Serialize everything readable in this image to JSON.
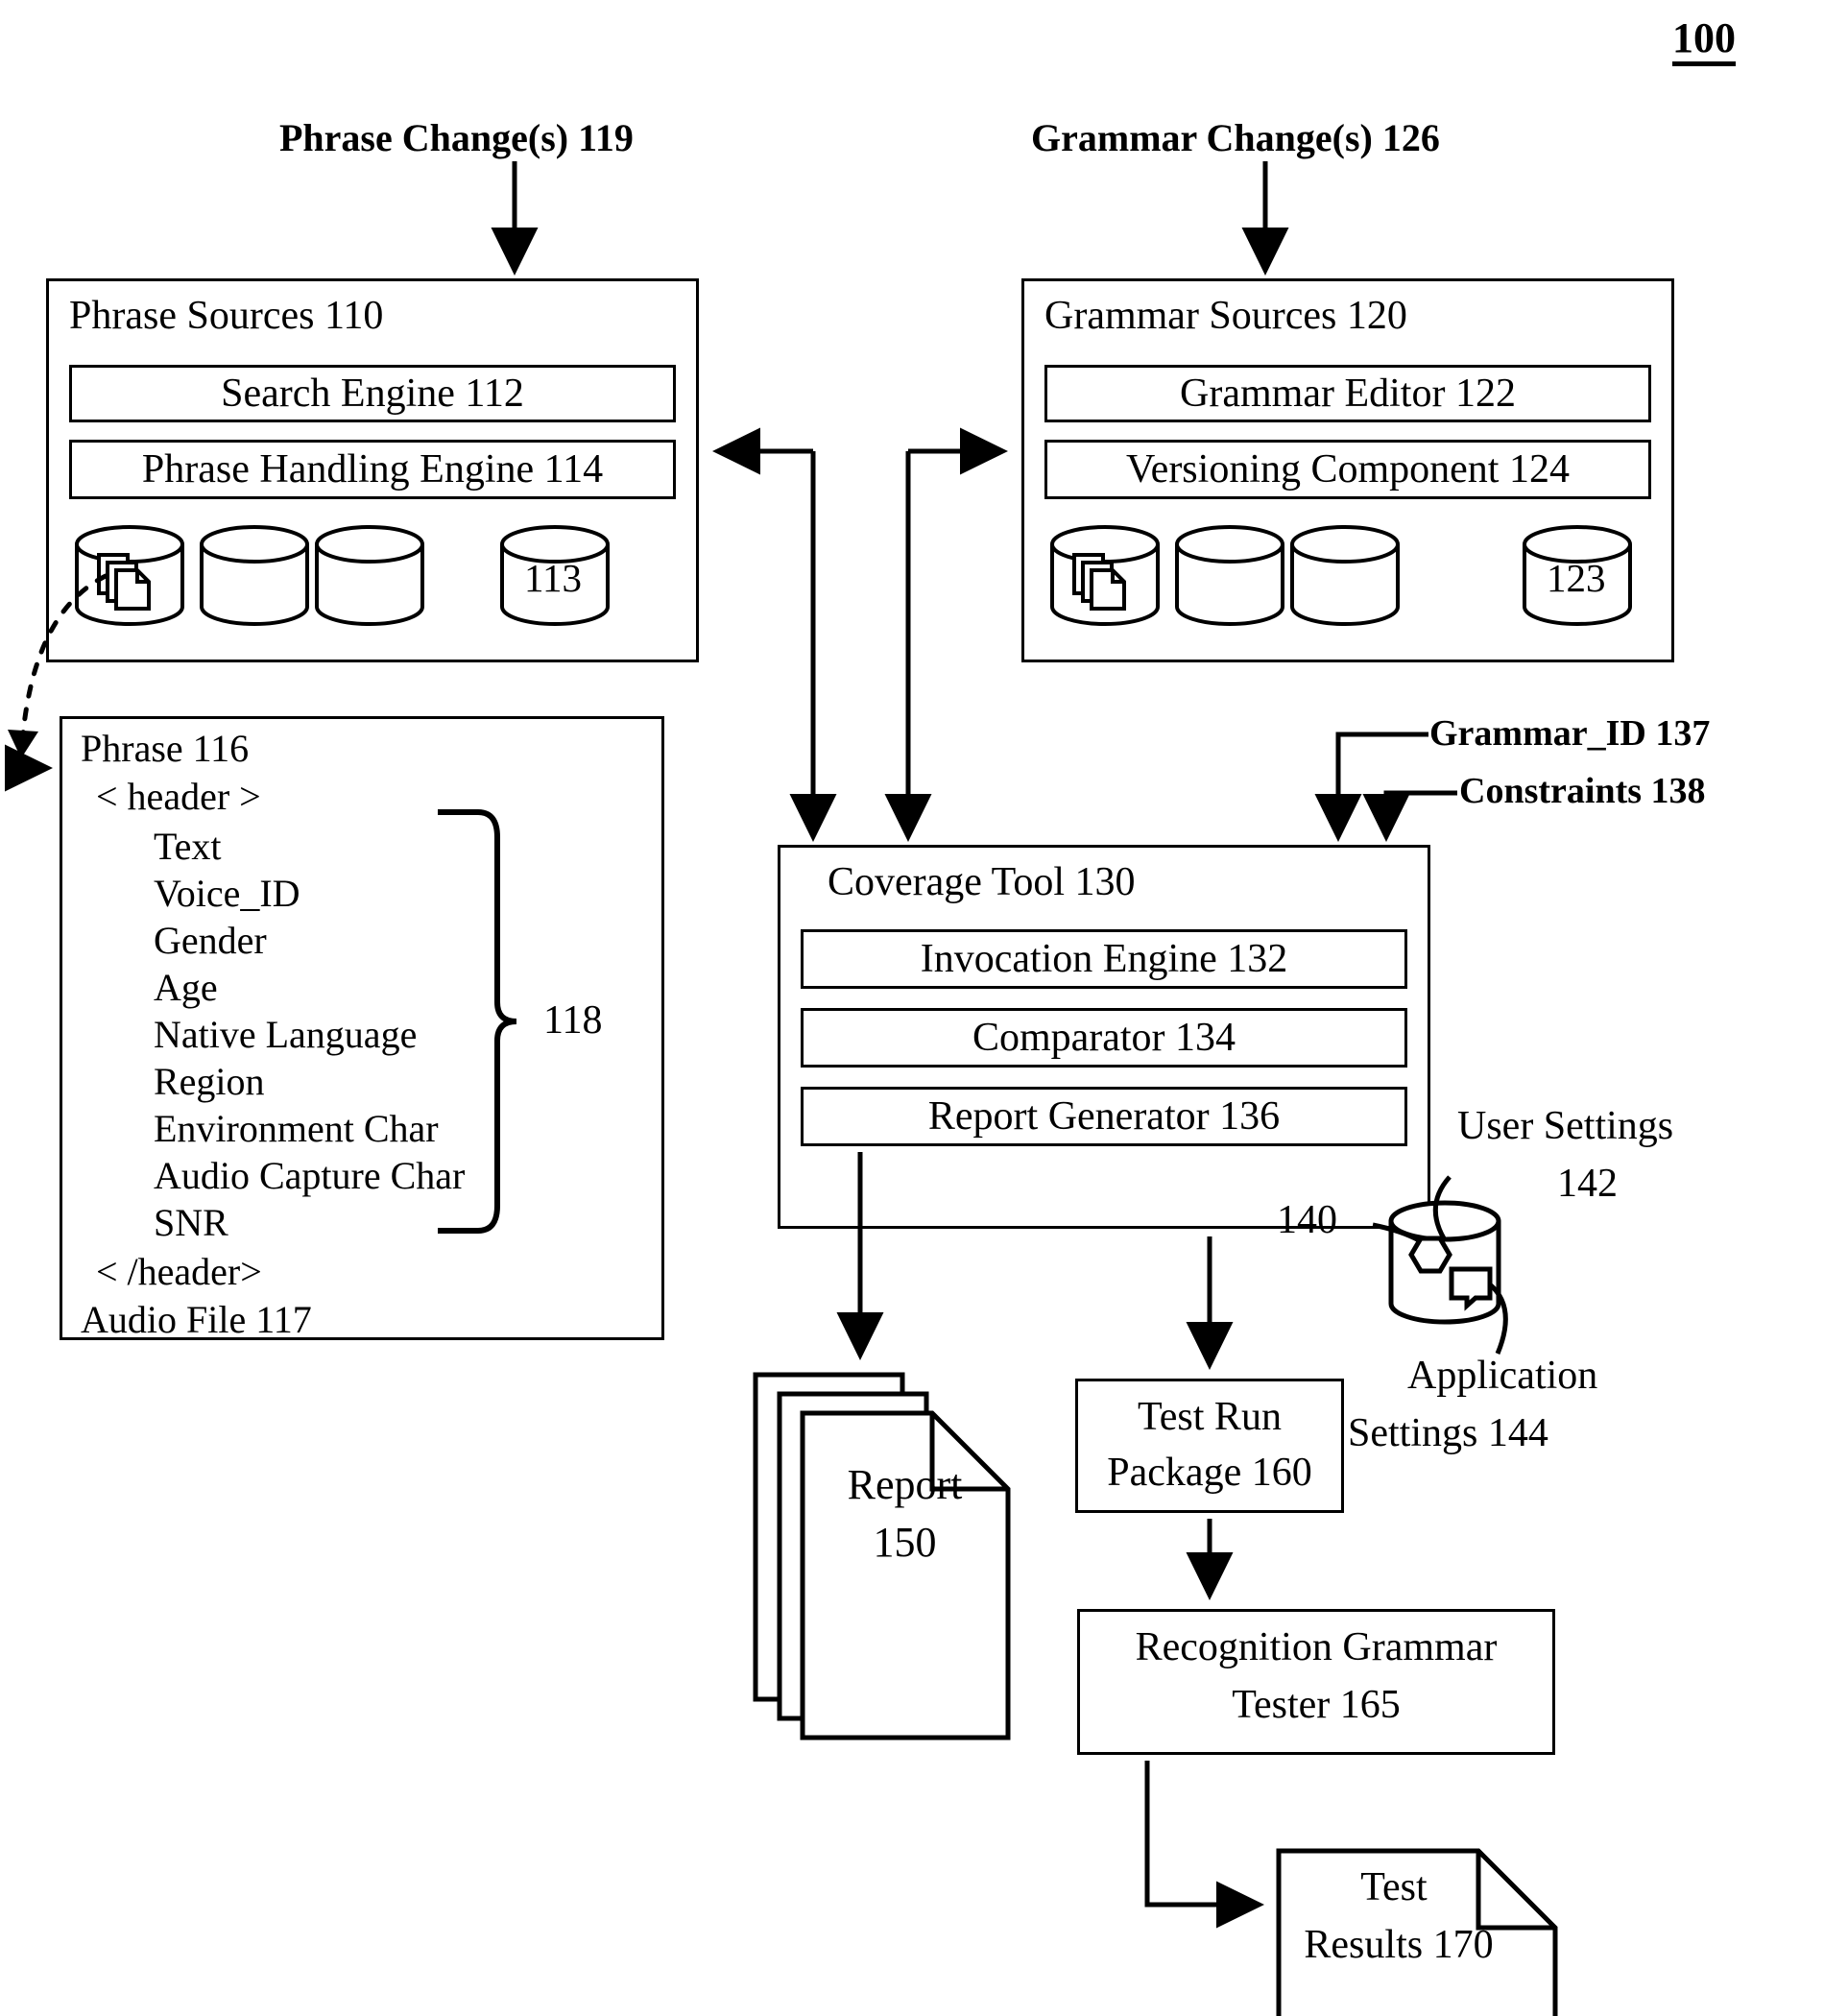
{
  "figure": {
    "number": "100"
  },
  "annotations": {
    "phrase_changes": "Phrase Change(s) 119",
    "grammar_changes": "Grammar Change(s) 126",
    "grammar_id": "Grammar_ID 137",
    "constraints": "Constraints 138",
    "settings_store_ref": "140",
    "user_settings": "User Settings",
    "user_settings_num": "142",
    "application_settings_line1": "Application",
    "application_settings_line2": "Settings 144",
    "header_brace_ref": "118"
  },
  "phrase_sources": {
    "title": "Phrase Sources 110",
    "components": [
      "Search Engine 112",
      "Phrase Handling Engine 114"
    ],
    "datastores": [
      "",
      "",
      "",
      "113"
    ],
    "datastore_icon": "documents-stack-icon"
  },
  "grammar_sources": {
    "title": "Grammar Sources 120",
    "components": [
      "Grammar Editor 122",
      "Versioning Component 124"
    ],
    "datastores": [
      "",
      "",
      "",
      "123"
    ],
    "datastore_icon": "documents-stack-icon"
  },
  "phrase_detail": {
    "title": "Phrase 116",
    "header_open": "< header >",
    "fields": [
      "Text",
      "Voice_ID",
      "Gender",
      "Age",
      "Native Language",
      "Region",
      "Environment Char",
      "Audio Capture Char",
      "SNR"
    ],
    "header_close": "< /header>",
    "audio_file": "Audio File 117"
  },
  "coverage_tool": {
    "title": "Coverage Tool 130",
    "components": [
      "Invocation Engine 132",
      "Comparator 134",
      "Report Generator 136"
    ]
  },
  "outputs": {
    "report_line1": "Report",
    "report_line2": "150",
    "test_run_package_line1": "Test Run",
    "test_run_package_line2": "Package 160",
    "recognition_tester_line1": "Recognition Grammar",
    "recognition_tester_line2": "Tester 165",
    "test_results_line1": "Test",
    "test_results_line2": "Results 170"
  },
  "colors": {
    "stroke": "#000000",
    "background": "#ffffff"
  }
}
